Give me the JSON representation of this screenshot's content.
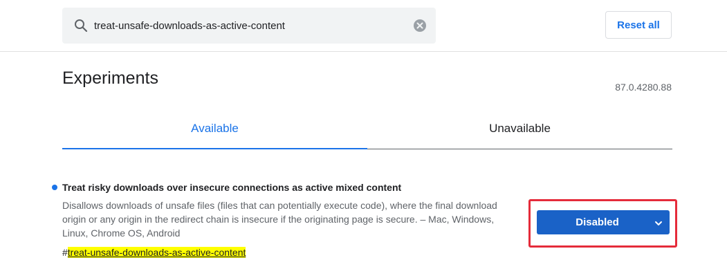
{
  "search": {
    "value": "treat-unsafe-downloads-as-active-content"
  },
  "toolbar": {
    "reset_label": "Reset all"
  },
  "page": {
    "title": "Experiments",
    "version": "87.0.4280.88"
  },
  "tabs": [
    {
      "label": "Available",
      "active": true
    },
    {
      "label": "Unavailable",
      "active": false
    }
  ],
  "experiment": {
    "title": "Treat risky downloads over insecure connections as active mixed content",
    "description": "Disallows downloads of unsafe files (files that can potentially execute code), where the final download origin or any origin in the redirect chain is insecure if the originating page is secure. – Mac, Windows, Linux, Chrome OS, Android",
    "hash": "#",
    "link": "treat-unsafe-downloads-as-active-content",
    "selected_option": "Disabled"
  },
  "colors": {
    "accent": "#1a73e8",
    "select_bg": "#1a62c7",
    "highlight_border": "#e52b3a",
    "link_highlight": "#ffff00"
  },
  "icons": [
    "search-icon",
    "clear-icon",
    "chevron-down-icon"
  ]
}
